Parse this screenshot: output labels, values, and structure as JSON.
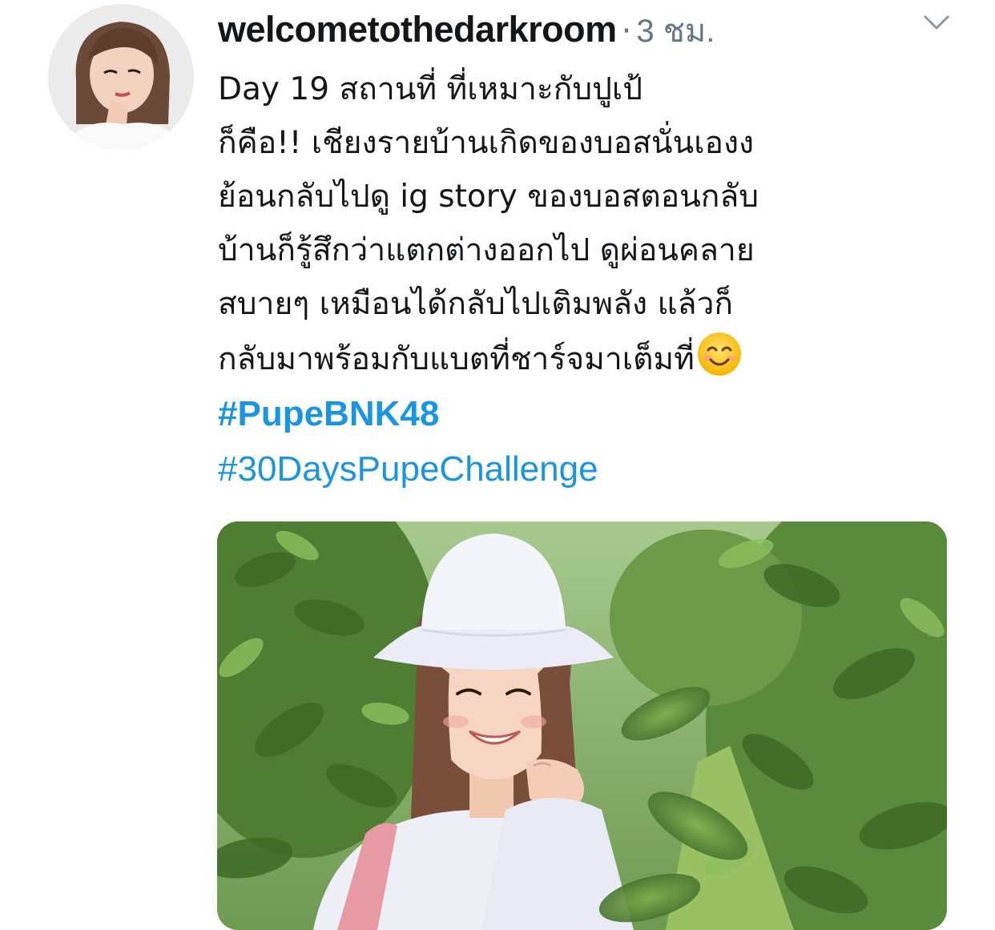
{
  "tweet": {
    "username": "welcometothedarkroom",
    "separator": "·",
    "time": "3 ชม.",
    "body_lines": [
      "Day 19 สถานที่ ที่เหมาะกับปูเป้",
      "ก็คือ!! เชียงรายบ้านเกิดของบอสนั่นเองง",
      "ย้อนกลับไปดู ig story ของบอสตอนกลับ",
      "บ้านก็รู้สึกว่าแตกต่างออกไป ดูผ่อนคลาย",
      "สบายๆ เหมือนได้กลับไปเติมพลัง แล้วก็",
      "กลับมาพร้อมกับแบตที่ชาร์จมาเต็มที่"
    ],
    "emoji": "smiling-face-with-smiling-eyes",
    "hashtags": [
      "#PupeBNK48",
      "#30DaysPupeChallenge"
    ],
    "colors": {
      "link": "#1b95e0",
      "text": "#14171a",
      "muted": "#657786"
    }
  }
}
